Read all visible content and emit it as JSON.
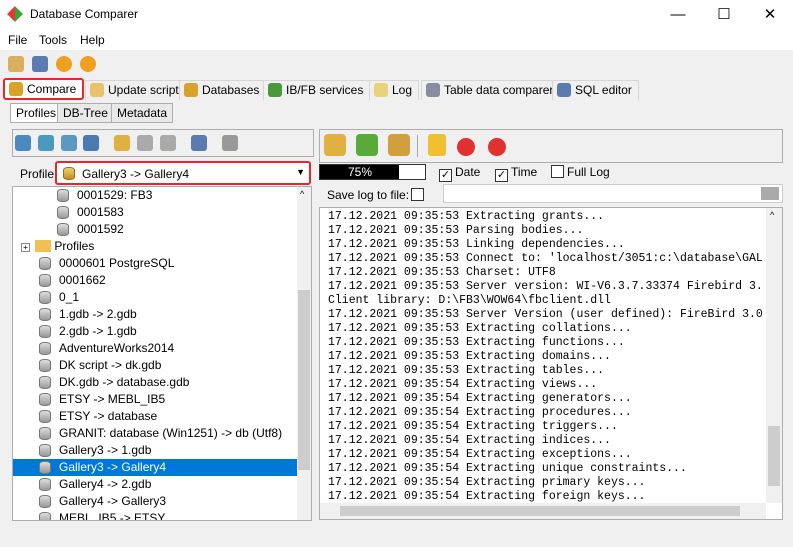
{
  "window": {
    "title": "Database Comparer",
    "minimize": "—",
    "maximize": "☐",
    "close": "✕"
  },
  "menu": [
    "File",
    "Tools",
    "Help"
  ],
  "tabs": [
    {
      "label": "Compare",
      "color": "#d9a32b"
    },
    {
      "label": "Update script",
      "color": "#e8c36b"
    },
    {
      "label": "Databases",
      "color": "#d9a32b"
    },
    {
      "label": "IB/FB services",
      "color": "#4a9a3a"
    },
    {
      "label": "Log",
      "color": "#e8d37b"
    },
    {
      "label": "Table data comparer",
      "color": "#8a8aa0"
    },
    {
      "label": "SQL editor",
      "color": "#5a7ab0"
    }
  ],
  "subtabs": [
    "Profiles",
    "DB-Tree",
    "Metadata"
  ],
  "profile": {
    "label": "Profile:",
    "value": "Gallery3 -> Gallery4"
  },
  "tree": {
    "children": [
      "0001529: FB3",
      "0001583",
      "0001592"
    ],
    "folder": "Profiles",
    "items": [
      "0000601 PostgreSQL",
      "0001662",
      "0_1",
      "1.gdb -> 2.gdb",
      "2.gdb -> 1.gdb",
      "AdventureWorks2014",
      "DK script -> dk.gdb",
      "DK.gdb -> database.gdb",
      "ETSY -> MEBL_IB5",
      "ETSY -> database",
      "GRANIT: database (Win1251) -> db (Utf8)",
      "Gallery3 -> 1.gdb",
      "Gallery3 -> Gallery4",
      "Gallery4 -> 2.gdb",
      "Gallery4 -> Gallery3",
      "MEBL_IB5 -> ETSY"
    ],
    "selected": "Gallery3 -> Gallery4"
  },
  "progress": {
    "value": 75,
    "label": "75%"
  },
  "options": {
    "date": {
      "label": "Date",
      "checked": true
    },
    "time": {
      "label": "Time",
      "checked": true
    },
    "fulllog": {
      "label": "Full Log",
      "checked": false
    },
    "savelog": {
      "label": "Save log to file:",
      "checked": false
    },
    "path": ""
  },
  "log": [
    "17.12.2021 09:35:53 Extracting grants...",
    "17.12.2021 09:35:53 Parsing bodies...",
    "17.12.2021 09:35:53 Linking dependencies...",
    "17.12.2021 09:35:53 Connect to: 'localhost/3051:c:\\database\\GAL",
    "17.12.2021 09:35:53 Charset: UTF8",
    "17.12.2021 09:35:53 Server version: WI-V6.3.7.33374 Firebird 3.",
    "Client library: D:\\FB3\\WOW64\\fbclient.dll",
    "17.12.2021 09:35:53 Server Version (user defined): FireBird 3.0",
    "17.12.2021 09:35:53 Extracting collations...",
    "17.12.2021 09:35:53 Extracting functions...",
    "17.12.2021 09:35:53 Extracting domains...",
    "17.12.2021 09:35:53 Extracting tables...",
    "17.12.2021 09:35:54 Extracting views...",
    "17.12.2021 09:35:54 Extracting generators...",
    "17.12.2021 09:35:54 Extracting procedures...",
    "17.12.2021 09:35:54 Extracting triggers...",
    "17.12.2021 09:35:54 Extracting indices...",
    "17.12.2021 09:35:54 Extracting exceptions...",
    "17.12.2021 09:35:54 Extracting unique constraints...",
    "17.12.2021 09:35:54 Extracting primary keys...",
    "17.12.2021 09:35:54 Extracting foreign keys..."
  ]
}
